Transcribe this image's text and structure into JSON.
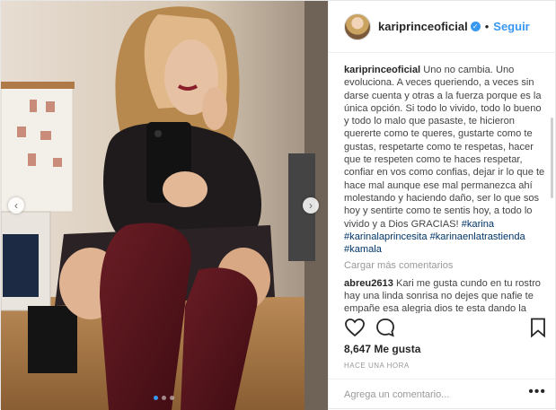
{
  "post": {
    "author": "kariprinceoficial",
    "follow_label": "Seguir",
    "separator": "•",
    "verified_mark": "✓",
    "caption_user": "kariprinceoficial",
    "caption_text": "Uno no cambia. Uno evoluciona. A veces queriendo, a veces sin darse cuenta y otras a la fuerza porque es la única opción. Si todo lo vivido, todo lo bueno y todo lo malo que pasaste, te hicieron quererte como te queres, gustarte como te gustas, respetarte como te respetas, hacer que te respeten como te haces respetar, confiar en vos como confias, dejar ir lo que te hace mal aunque ese mal permanezca ahí molestando y haciendo daño, ser lo que sos hoy y sentirte como te sentis hoy, a todo lo vivido y a Dios GRACIAS!",
    "hashtags": "#karina #karinalaprincesita #karinaenlatrastienda #kamala",
    "load_more": "Cargar más comentarios",
    "comment_user": "abreu2613",
    "comment_text": "Kari me gusta cundo en tu rostro hay una linda sonrisa no dejes que nafie te empañe esa alegria dios te esta dando la oportunidad de saber que tu vales",
    "likes": "8,647 Me gusta",
    "time": "HACE UNA HORA",
    "add_comment_placeholder": "Agrega un comentario...",
    "more_options": "•••"
  },
  "icons": {
    "heart": "heart-icon",
    "comment": "comment-icon",
    "bookmark": "bookmark-icon",
    "prev": "chevron-left-icon",
    "next": "chevron-right-icon"
  },
  "carousel": {
    "prev_glyph": "‹",
    "next_glyph": "›",
    "slides": 3,
    "active": 0
  },
  "colors": {
    "link": "#3897f0",
    "hashtag": "#003569",
    "muted": "#999999"
  }
}
